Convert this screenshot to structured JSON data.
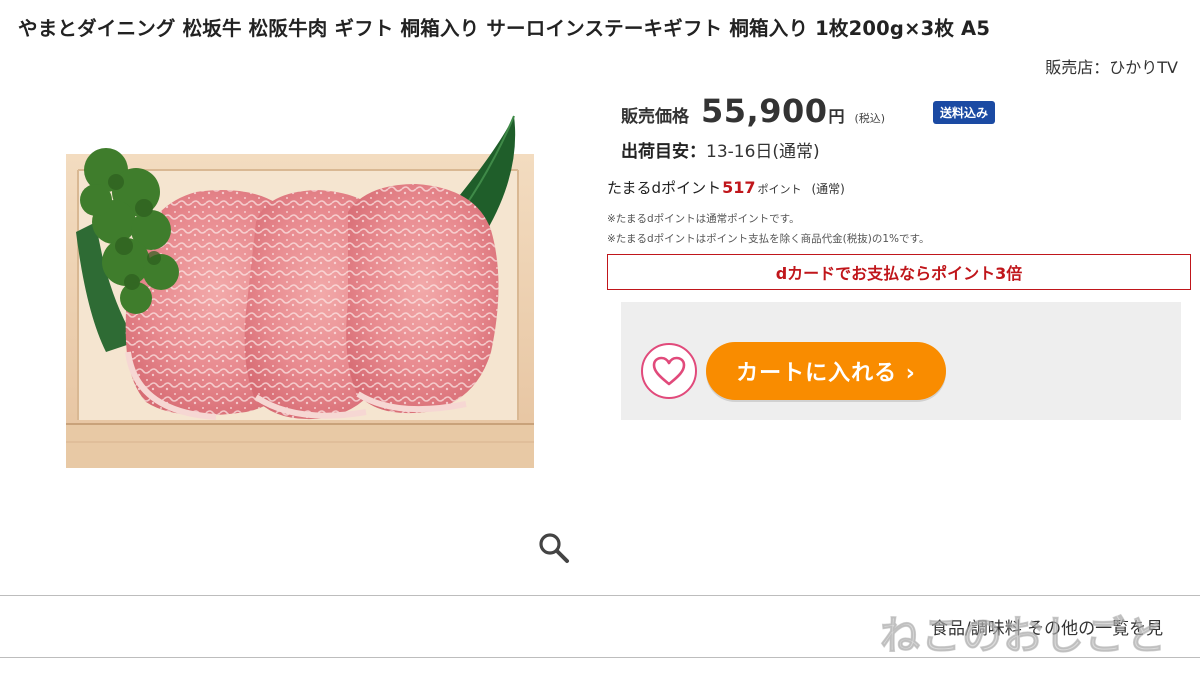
{
  "product": {
    "title": "やまとダイニング 松坂牛 松阪牛肉 ギフト 桐箱入り サーロインステーキギフト 桐箱入り 1枚200g×3枚 A5",
    "seller": "販売店：ひかりTV"
  },
  "price": {
    "label": "販売価格",
    "value": "55,900",
    "unit": "円",
    "tax_note": "(税込)",
    "shipping_badge": "送料込み"
  },
  "shipping": {
    "label": "出荷目安：",
    "value": "13-16日(通常)"
  },
  "points": {
    "label": "たまるdポイント",
    "value": "517",
    "unit": "ポイント",
    "note": "(通常)",
    "fine_1": "※たまるdポイントは通常ポイントです。",
    "fine_2": "※たまるdポイントはポイント支払を除く商品代金(税抜)の1%です。"
  },
  "dcard_promo": "dカードでお支払ならポイント3倍",
  "cart": {
    "add_label": "カートに入れる ›",
    "favorite_icon": "heart-icon"
  },
  "footer": {
    "category_link": "食品/調味料 その他の一覧を見",
    "watermark": "ねこのおしごと"
  },
  "colors": {
    "accent_orange": "#f98c00",
    "promo_red": "#c0161b",
    "badge_blue": "#1b4aa3",
    "heart_pink": "#e14a7b"
  }
}
